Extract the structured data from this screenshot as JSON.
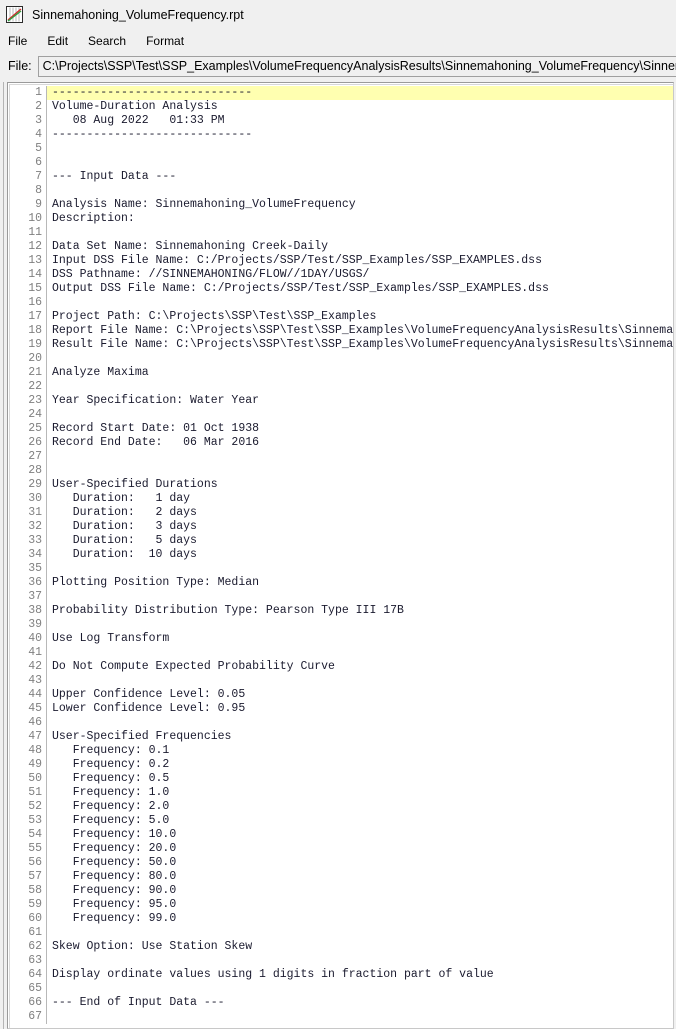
{
  "window": {
    "title": "Sinnemahoning_VolumeFrequency.rpt",
    "icon": "plot-chart-icon"
  },
  "menubar": {
    "items": [
      {
        "label": "File"
      },
      {
        "label": "Edit"
      },
      {
        "label": "Search"
      },
      {
        "label": "Format"
      }
    ]
  },
  "file_row": {
    "label": "File:",
    "path": "C:\\Projects\\SSP\\Test\\SSP_Examples\\VolumeFrequencyAnalysisResults\\Sinnemahoning_VolumeFrequency\\Sinnemahoning_VolumeFrequency.rpt",
    "placeholder": ""
  },
  "colors": {
    "highlight_line": "#ffffb0",
    "line_number": "#808080",
    "text": "#1a1a2e",
    "window_bg": "#f0f0f0",
    "editor_bg": "#ffffff"
  },
  "editor": {
    "highlighted_line": 1,
    "lines": [
      {
        "n": 1,
        "t": "-----------------------------"
      },
      {
        "n": 2,
        "t": "Volume-Duration Analysis"
      },
      {
        "n": 3,
        "t": "   08 Aug 2022   01:33 PM"
      },
      {
        "n": 4,
        "t": "-----------------------------"
      },
      {
        "n": 5,
        "t": ""
      },
      {
        "n": 6,
        "t": ""
      },
      {
        "n": 7,
        "t": "--- Input Data ---"
      },
      {
        "n": 8,
        "t": ""
      },
      {
        "n": 9,
        "t": "Analysis Name: Sinnemahoning_VolumeFrequency"
      },
      {
        "n": 10,
        "t": "Description:"
      },
      {
        "n": 11,
        "t": ""
      },
      {
        "n": 12,
        "t": "Data Set Name: Sinnemahoning Creek-Daily"
      },
      {
        "n": 13,
        "t": "Input DSS File Name: C:/Projects/SSP/Test/SSP_Examples/SSP_EXAMPLES.dss"
      },
      {
        "n": 14,
        "t": "DSS Pathname: //SINNEMAHONING/FLOW//1DAY/USGS/"
      },
      {
        "n": 15,
        "t": "Output DSS File Name: C:/Projects/SSP/Test/SSP_Examples/SSP_EXAMPLES.dss"
      },
      {
        "n": 16,
        "t": ""
      },
      {
        "n": 17,
        "t": "Project Path: C:\\Projects\\SSP\\Test\\SSP_Examples"
      },
      {
        "n": 18,
        "t": "Report File Name: C:\\Projects\\SSP\\Test\\SSP_Examples\\VolumeFrequencyAnalysisResults\\Sinnemahoning_VolumeFrequency\\Sinnemahoning_VolumeFrequency.rpt"
      },
      {
        "n": 19,
        "t": "Result File Name: C:\\Projects\\SSP\\Test\\SSP_Examples\\VolumeFrequencyAnalysisResults\\Sinnemahoning_VolumeFrequency\\Sinnemahoning_VolumeFrequency.xml"
      },
      {
        "n": 20,
        "t": ""
      },
      {
        "n": 21,
        "t": "Analyze Maxima"
      },
      {
        "n": 22,
        "t": ""
      },
      {
        "n": 23,
        "t": "Year Specification: Water Year"
      },
      {
        "n": 24,
        "t": ""
      },
      {
        "n": 25,
        "t": "Record Start Date: 01 Oct 1938"
      },
      {
        "n": 26,
        "t": "Record End Date:   06 Mar 2016"
      },
      {
        "n": 27,
        "t": ""
      },
      {
        "n": 28,
        "t": ""
      },
      {
        "n": 29,
        "t": "User-Specified Durations"
      },
      {
        "n": 30,
        "t": "   Duration:   1 day"
      },
      {
        "n": 31,
        "t": "   Duration:   2 days"
      },
      {
        "n": 32,
        "t": "   Duration:   3 days"
      },
      {
        "n": 33,
        "t": "   Duration:   5 days"
      },
      {
        "n": 34,
        "t": "   Duration:  10 days"
      },
      {
        "n": 35,
        "t": ""
      },
      {
        "n": 36,
        "t": "Plotting Position Type: Median"
      },
      {
        "n": 37,
        "t": ""
      },
      {
        "n": 38,
        "t": "Probability Distribution Type: Pearson Type III 17B"
      },
      {
        "n": 39,
        "t": ""
      },
      {
        "n": 40,
        "t": "Use Log Transform"
      },
      {
        "n": 41,
        "t": ""
      },
      {
        "n": 42,
        "t": "Do Not Compute Expected Probability Curve"
      },
      {
        "n": 43,
        "t": ""
      },
      {
        "n": 44,
        "t": "Upper Confidence Level: 0.05"
      },
      {
        "n": 45,
        "t": "Lower Confidence Level: 0.95"
      },
      {
        "n": 46,
        "t": ""
      },
      {
        "n": 47,
        "t": "User-Specified Frequencies"
      },
      {
        "n": 48,
        "t": "   Frequency: 0.1"
      },
      {
        "n": 49,
        "t": "   Frequency: 0.2"
      },
      {
        "n": 50,
        "t": "   Frequency: 0.5"
      },
      {
        "n": 51,
        "t": "   Frequency: 1.0"
      },
      {
        "n": 52,
        "t": "   Frequency: 2.0"
      },
      {
        "n": 53,
        "t": "   Frequency: 5.0"
      },
      {
        "n": 54,
        "t": "   Frequency: 10.0"
      },
      {
        "n": 55,
        "t": "   Frequency: 20.0"
      },
      {
        "n": 56,
        "t": "   Frequency: 50.0"
      },
      {
        "n": 57,
        "t": "   Frequency: 80.0"
      },
      {
        "n": 58,
        "t": "   Frequency: 90.0"
      },
      {
        "n": 59,
        "t": "   Frequency: 95.0"
      },
      {
        "n": 60,
        "t": "   Frequency: 99.0"
      },
      {
        "n": 61,
        "t": ""
      },
      {
        "n": 62,
        "t": "Skew Option: Use Station Skew"
      },
      {
        "n": 63,
        "t": ""
      },
      {
        "n": 64,
        "t": "Display ordinate values using 1 digits in fraction part of value"
      },
      {
        "n": 65,
        "t": ""
      },
      {
        "n": 66,
        "t": "--- End of Input Data ---"
      },
      {
        "n": 67,
        "t": ""
      }
    ]
  }
}
